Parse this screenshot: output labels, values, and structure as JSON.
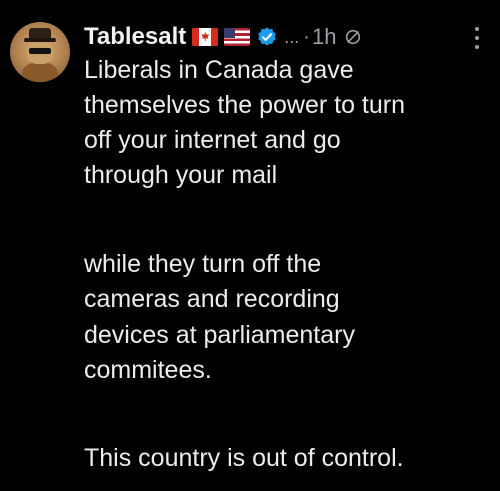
{
  "post": {
    "author": {
      "display_name": "Tablesalt",
      "flags": [
        "canada-flag",
        "usa-flag"
      ],
      "verified": true
    },
    "dots": "...",
    "separator": "·",
    "time": "1h",
    "body_lines": [
      "Liberals in Canada gave",
      "themselves the power to turn",
      "off your internet and go",
      "through your mail",
      "while they turn off the",
      "cameras and recording",
      "devices at parliamentary",
      "commitees.",
      "This country is out of control."
    ]
  },
  "icons": {
    "verified": "verified-badge-icon",
    "nosign": "no-entry-icon",
    "more": "more-options-icon"
  },
  "colors": {
    "background": "#000000",
    "text": "#e7e9ea",
    "muted": "#9aa0a6",
    "verified": "#1d9bf0"
  }
}
